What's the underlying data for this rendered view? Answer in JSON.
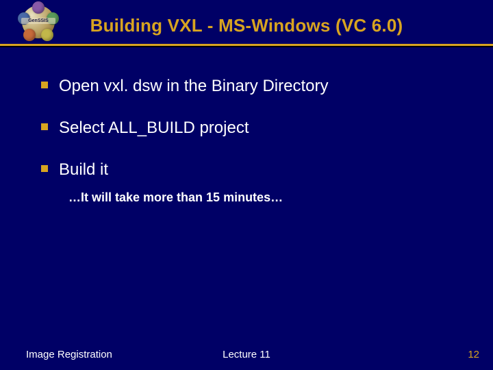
{
  "header": {
    "logo_label": "GenSSIS",
    "title": "Building VXL - MS-Windows (VC 6.0)"
  },
  "bullets": [
    {
      "text": "Open   vxl. dsw   in the Binary Directory"
    },
    {
      "text": "Select ALL_BUILD project"
    },
    {
      "text": "Build it"
    }
  ],
  "subnote": "…It will take more than 15 minutes…",
  "footer": {
    "left": "Image Registration",
    "center": "Lecture 11",
    "right": "12"
  }
}
